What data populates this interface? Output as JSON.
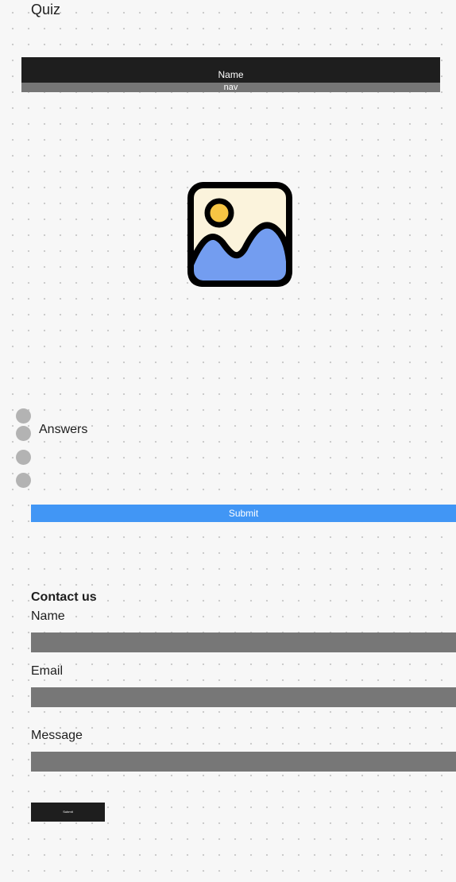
{
  "page": {
    "title": "Quiz"
  },
  "header": {
    "name": "Name",
    "nav": "nav"
  },
  "quiz": {
    "image_icon": "image-placeholder-icon",
    "answers_label": "Answers",
    "option_count": 4,
    "submit_label": "Submit"
  },
  "contact": {
    "heading": "Contact us",
    "name_label": "Name",
    "email_label": "Email",
    "message_label": "Message",
    "send_label": "Submit"
  },
  "colors": {
    "dark": "#1e1e1e",
    "nav_gray": "#757575",
    "field_gray": "#777777",
    "accent_blue": "#4196f5",
    "radio_gray": "#b3b3b3"
  }
}
